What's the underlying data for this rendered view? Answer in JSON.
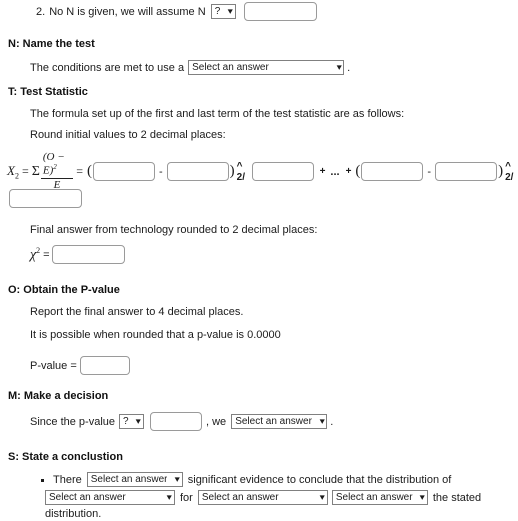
{
  "question": {
    "number": "2.",
    "prompt": "No N is given, we will assume N",
    "assume_select_value": "?",
    "assume_input_value": "",
    "assume_input_placeholder": ""
  },
  "sections": {
    "name": {
      "heading": "N: Name the test",
      "condition_text_before": "The conditions are met to use a",
      "condition_select_value": "Select an answer",
      "condition_text_after": "."
    },
    "test_statistic": {
      "heading": "T: Test Statistic",
      "line1": "The formula set up of the first and last term of the test statistic are as follows:",
      "line2": "Round initial values to 2 decimal places:",
      "formula": {
        "lhs_symbol": "X",
        "lhs_subscript": "2",
        "equals": "=",
        "sigma": "Σ",
        "numerator": "(O − E)",
        "numerator_exponent": "2",
        "denominator": "E",
        "equals2": "=",
        "open_paren": "(",
        "minus": "-",
        "close_paren": ")",
        "power": "^ 2/",
        "plus": "+",
        "ellipsis": "...",
        "plus2": "+",
        "inputs": {
          "term1_observed": "",
          "term1_expected": "",
          "term1_divisor": "",
          "term2_observed": "",
          "term2_expected": "",
          "term2_divisor": ""
        }
      },
      "final_answer_text": "Final answer from technology rounded to 2 decimal places:",
      "chi_label": "χ",
      "chi_exponent": "2",
      "chi_equals": "=",
      "chi_value": ""
    },
    "pvalue": {
      "heading": "O: Obtain the P-value",
      "line1": "Report the final answer to 4 decimal places.",
      "line2": "It is possible when rounded that a p-value is 0.0000",
      "label": "P-value =",
      "value": ""
    },
    "decision": {
      "heading": "M: Make a decision",
      "text_before": "Since the p-value",
      "compare_select_value": "?",
      "compare_input_value": "",
      "text_middle": ", we",
      "action_select_value": "Select an answer",
      "text_after": "."
    },
    "conclusion": {
      "heading": "S: State a conclustion",
      "text_there": "There",
      "evidence_select_value": "Select an answer",
      "text_significant": "significant evidence to conclude that the distribution of",
      "subject_select_value": "Select an answer",
      "text_for": "for",
      "group_select_value": "Select an answer",
      "fit_select_value": "Select an answer",
      "text_stated": "the stated",
      "text_distribution": "distribution."
    }
  },
  "icons": {
    "chevron_down": "⌄"
  },
  "colors": {
    "text": "#1b1b1b",
    "border_input": "#9a9a9a",
    "border_select": "#808080",
    "background": "#ffffff"
  }
}
